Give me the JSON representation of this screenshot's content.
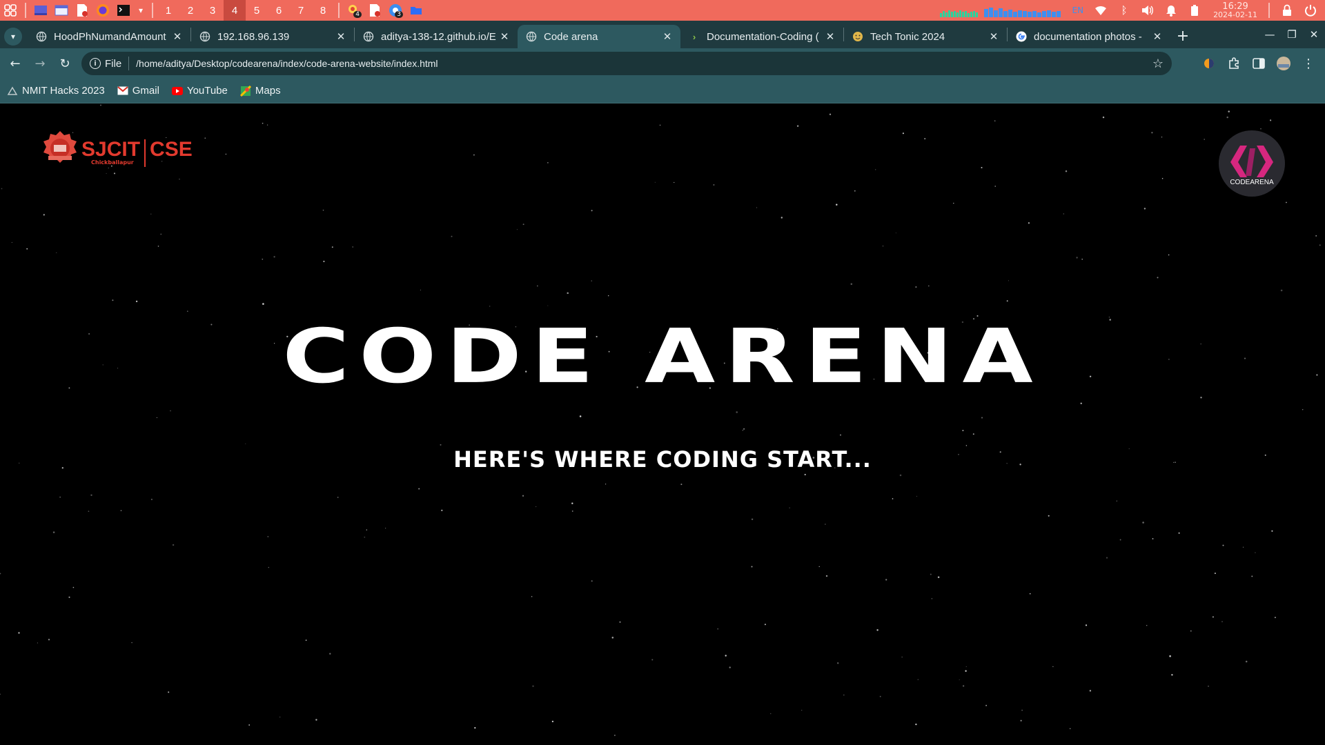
{
  "system_bar": {
    "workspaces": [
      "1",
      "2",
      "3",
      "4",
      "5",
      "6",
      "7",
      "8"
    ],
    "active_workspace": "4",
    "tray_badges": [
      "4",
      "3"
    ],
    "keyboard_layout": "EN",
    "clock_time": "16:29",
    "clock_date": "2024-02-11",
    "colors": {
      "bar": "#f06a5c",
      "active_ws": "#c94a3f"
    }
  },
  "tabs": [
    {
      "title": "HoodPhNumandAmount",
      "icon": "globe-icon"
    },
    {
      "title": "192.168.96.139",
      "icon": "globe-icon"
    },
    {
      "title": "aditya-138-12.github.io/E",
      "icon": "globe-icon"
    },
    {
      "title": "Code arena",
      "icon": "globe-icon",
      "active": true
    },
    {
      "title": "Documentation-Coding (",
      "icon": "terminal-icon"
    },
    {
      "title": "Tech Tonic 2024",
      "icon": "smiley-icon"
    },
    {
      "title": "documentation photos -",
      "icon": "google-icon"
    }
  ],
  "toolbar": {
    "site_info": "File",
    "url": "/home/aditya/Desktop/codearena/index/code-arena-website/index.html"
  },
  "bookmarks": [
    {
      "label": "NMIT Hacks 2023",
      "icon": "nmit-icon"
    },
    {
      "label": "Gmail",
      "icon": "gmail-icon"
    },
    {
      "label": "YouTube",
      "icon": "youtube-icon"
    },
    {
      "label": "Maps",
      "icon": "maps-icon"
    }
  ],
  "page": {
    "left_logo": {
      "main": "SJCIT",
      "dept": "CSE",
      "sub": "Chickballapur"
    },
    "right_logo": {
      "caption": "CODEARENA"
    },
    "hero_title": "CODE ARENA",
    "tagline": "HERE'S WHERE CODING START...",
    "colors": {
      "background": "#000000",
      "brand_red": "#e23a2e",
      "logo_pink": "#d6277f"
    }
  }
}
